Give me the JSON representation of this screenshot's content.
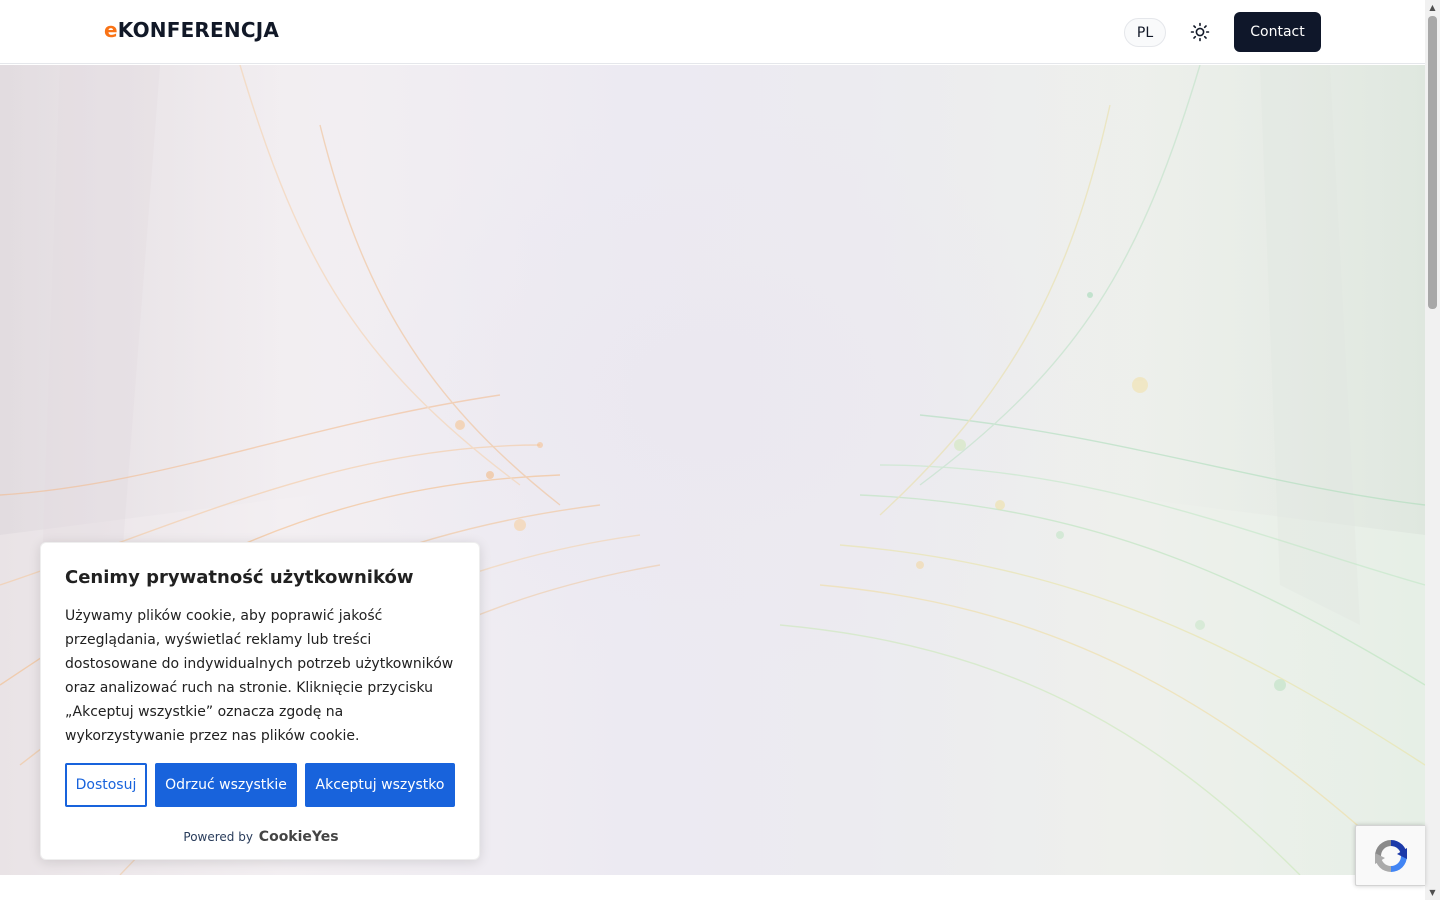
{
  "header": {
    "logo_accent": "e",
    "logo_rest": "KONFERENCJA",
    "language": "PL",
    "theme_toggle_icon": "sun-icon",
    "contact_label": "Contact"
  },
  "cookie_banner": {
    "title": "Cenimy prywatność użytkowników",
    "text": "Używamy plików cookie, aby poprawić jakość przeglądania, wyświetlać reklamy lub treści dostosowane do indywidualnych potrzeb użytkowników oraz analizować ruch na stronie. Kliknięcie przycisku „Akceptuj wszystkie” oznacza zgodę na wykorzystywanie przez nas plików cookie.",
    "customize_label": "Dostosuj",
    "reject_label": "Odrzuć wszystkie",
    "accept_label": "Akceptuj wszystko",
    "powered_by": "Powered by",
    "powered_brand": "CookieYes"
  },
  "colors": {
    "logo_accent": "#f97316",
    "contact_bg": "#0f172a",
    "cookie_button": "#1863dc"
  },
  "icons": {
    "theme": "sun-icon",
    "recaptcha": "recaptcha-icon",
    "scroll_up": "arrow-up-icon",
    "scroll_down": "arrow-down-icon"
  }
}
